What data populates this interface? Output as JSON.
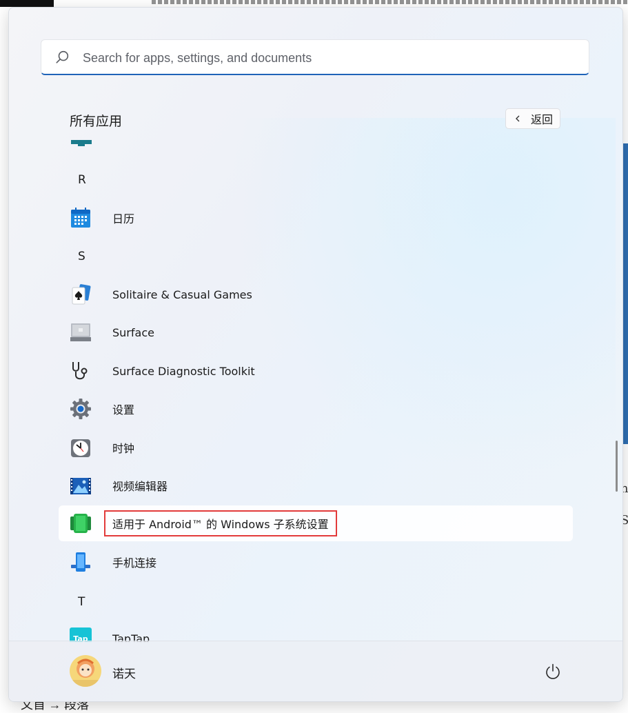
{
  "search": {
    "placeholder": "Search for apps, settings, and documents",
    "value": ""
  },
  "header": {
    "title": "所有应用",
    "back_label": "返回"
  },
  "letters": {
    "r": "R",
    "s": "S",
    "t": "T"
  },
  "apps": [
    {
      "label": "日历",
      "icon": "calendar-icon"
    },
    {
      "label": "Solitaire & Casual Games",
      "icon": "solitaire-icon"
    },
    {
      "label": "Surface",
      "icon": "surface-icon"
    },
    {
      "label": "Surface Diagnostic Toolkit",
      "icon": "stethoscope-icon"
    },
    {
      "label": "设置",
      "icon": "settings-gear-icon"
    },
    {
      "label": "时钟",
      "icon": "clock-icon"
    },
    {
      "label": "视频编辑器",
      "icon": "video-editor-icon"
    },
    {
      "label": "适用于 Android™ 的 Windows 子系统设置",
      "icon": "android-subsystem-icon"
    },
    {
      "label": "手机连接",
      "icon": "phone-link-icon"
    },
    {
      "label": "TapTap",
      "icon": "taptap-icon",
      "icon_text": "Tap"
    }
  ],
  "footer": {
    "user_name": "诺天"
  },
  "colors": {
    "accent": "#1f63b8",
    "highlight_border": "#e23a3a",
    "taptap": "#17c3d6"
  },
  "background": {
    "bottom_text": "文首 → 段落",
    "right_letters": [
      "h",
      "S"
    ]
  }
}
